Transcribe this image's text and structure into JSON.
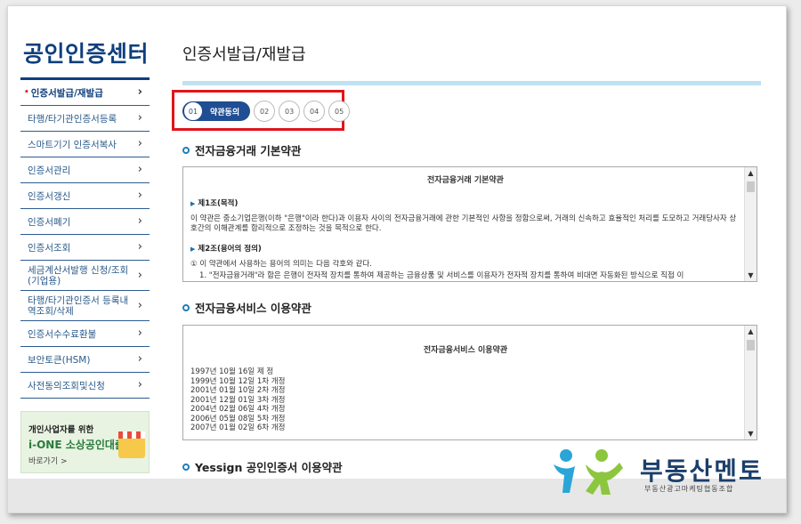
{
  "sidebar": {
    "logo": "공인인증센터",
    "items": [
      {
        "label": "인증서발급/재발급",
        "active": true
      },
      {
        "label": "타행/타기관인증서등록"
      },
      {
        "label": "스마트기기 인증서복사"
      },
      {
        "label": "인증서관리"
      },
      {
        "label": "인증서갱신"
      },
      {
        "label": "인증서폐기"
      },
      {
        "label": "인증서조회"
      },
      {
        "label": "세금계산서발행 신청/조회(기업용)"
      },
      {
        "label": "타행/타기관인증서 등록내역조회/삭제"
      },
      {
        "label": "인증서수수료환불"
      },
      {
        "label": "보안토큰(HSM)"
      },
      {
        "label": "사전동의조회및신청"
      }
    ],
    "banner": {
      "line1": "개인사업자를 위한",
      "line2": "i-ONE 소상공인대출",
      "line3": "바로가기 >"
    }
  },
  "main": {
    "title": "인증서발급/재발급",
    "steps": {
      "active_num": "01",
      "active_label": "약관동의",
      "others": [
        "02",
        "03",
        "04",
        "05"
      ]
    },
    "sections": [
      {
        "title": "전자금융거래 기본약관",
        "doc_title": "전자금융거래 기본약관",
        "art1_title": "제1조(목적)",
        "art1_text": "이 약관은 중소기업은행(이하 \"은행\"이라 한다)과 이용자 사이의 전자금융거래에 관한 기본적인 사항을 정함으로써, 거래의 신속하고 효율적인 처리를 도모하고 거래당사자 상호간의 이해관계를 합리적으로 조정하는 것을 목적으로 한다.",
        "art2_title": "제2조(용어의 정의)",
        "art2_text": "① 이 약관에서 사용하는 용어의 의미는 다음 각호와 같다.",
        "art2_item": "1. \"전자금융거래\"라 함은 은행이 전자적 장치를 통하여 제공하는 금융상품 및 서비스를 이용자가 전자적 장치를 통하여 비대면 자동화된 방식으로 직접 이"
      },
      {
        "title": "전자금융서비스 이용약관",
        "doc_title": "전자금융서비스 이용약관",
        "history": [
          "1997년 10월 16일 제 정",
          "1999년 10월 12일 1차 개정",
          "2001년 01월 10일 2차 개정",
          "2001년 12월 01일 3차 개정",
          "2004년 02월 06일 4차 개정",
          "2006년 05월 08일 5차 개정",
          "2007년 01월 02일 6차 개정"
        ]
      },
      {
        "title": "Yessign 공인인증서 이용약관"
      }
    ]
  },
  "watermark": {
    "text": "부동산멘토",
    "sub": "부동산광고마케팅협동조합"
  },
  "colors": {
    "brand_navy": "#0e3f7d",
    "step_active": "#1f4e92",
    "highlight_red": "#e0141a",
    "title_bar": "#bfe2f2"
  }
}
